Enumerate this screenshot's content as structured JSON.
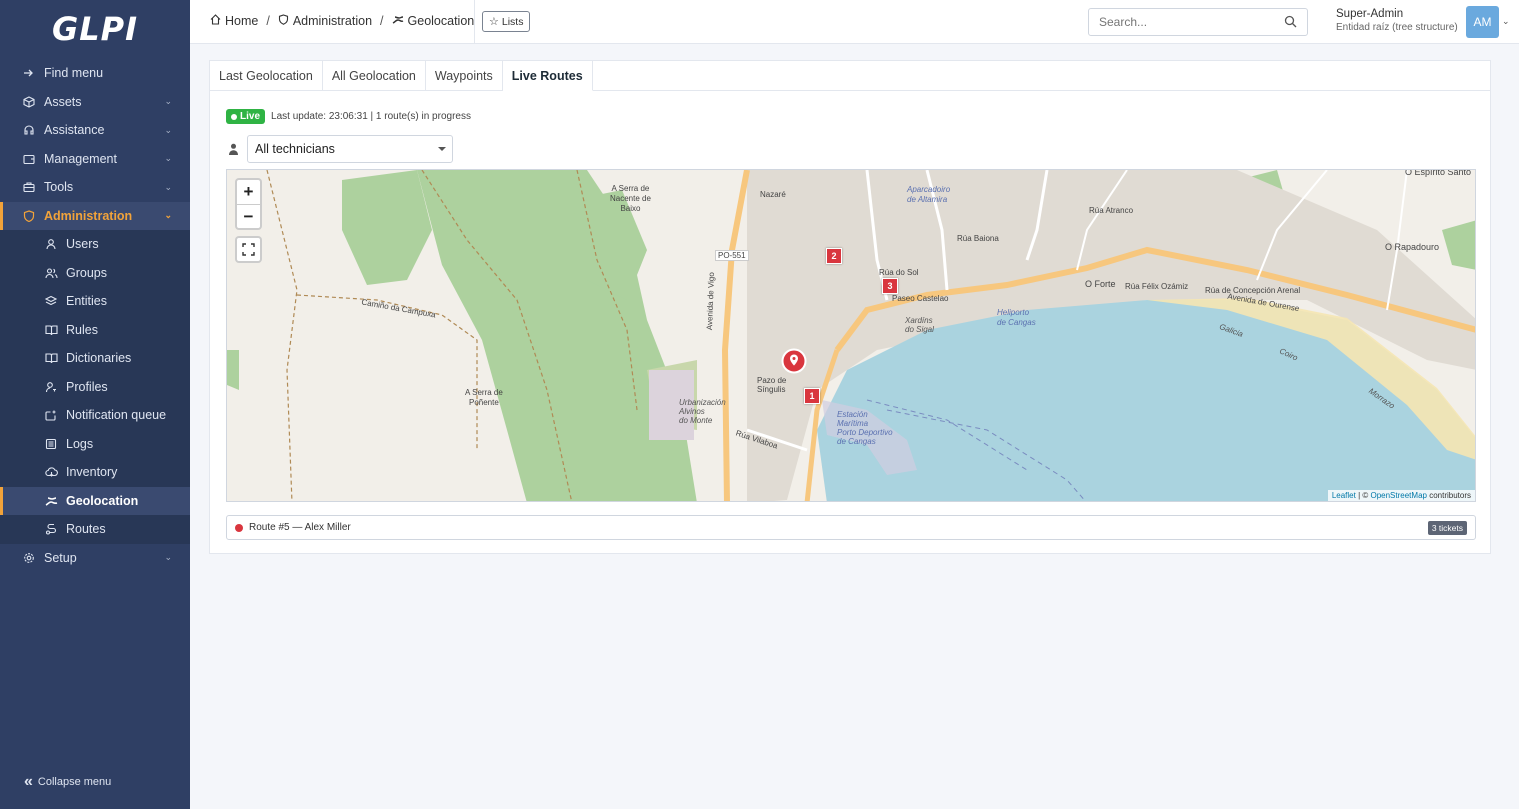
{
  "app": {
    "logo_text": "GLPI"
  },
  "sidebar": {
    "items": [
      {
        "label": "Find menu",
        "icon": "arrow-right-icon"
      },
      {
        "label": "Assets",
        "icon": "box-icon"
      },
      {
        "label": "Assistance",
        "icon": "headset-icon"
      },
      {
        "label": "Management",
        "icon": "wallet-icon"
      },
      {
        "label": "Tools",
        "icon": "briefcase-icon"
      },
      {
        "label": "Administration",
        "icon": "shield-icon"
      },
      {
        "label": "Setup",
        "icon": "gear-icon"
      }
    ],
    "admin_sub": [
      {
        "label": "Users",
        "icon": "user-icon"
      },
      {
        "label": "Groups",
        "icon": "users-icon"
      },
      {
        "label": "Entities",
        "icon": "stack-icon"
      },
      {
        "label": "Rules",
        "icon": "book-icon"
      },
      {
        "label": "Dictionaries",
        "icon": "book-icon"
      },
      {
        "label": "Profiles",
        "icon": "user-key-icon"
      },
      {
        "label": "Notification queue",
        "icon": "mail-icon"
      },
      {
        "label": "Logs",
        "icon": "log-icon"
      },
      {
        "label": "Inventory",
        "icon": "cloud-icon"
      },
      {
        "label": "Geolocation",
        "icon": "route-icon"
      },
      {
        "label": "Routes",
        "icon": "route-icon"
      }
    ],
    "collapse_label": "Collapse menu",
    "accent_color": "#f2a33a",
    "bg_color": "#2f3f64"
  },
  "header": {
    "breadcrumb": [
      "Home",
      "Administration",
      "Geolocation"
    ],
    "lists_label": "Lists",
    "search_placeholder": "Search...",
    "user_name": "Super-Admin",
    "user_entity": "Entidad raíz (tree structure)",
    "avatar_initials": "AM"
  },
  "tabs": [
    "Last Geolocation",
    "All Geolocation",
    "Waypoints",
    "Live Routes"
  ],
  "active_tab": "Live Routes",
  "live": {
    "badge": "Live",
    "status_text": "Last update: 23:06:31 | 1 route(s) in progress",
    "badge_color": "#2fb344"
  },
  "filter": {
    "selected": "All technicians"
  },
  "map": {
    "zoom_in": "+",
    "zoom_out": "−",
    "attribution_leaflet": "Leaflet",
    "attribution_sep": " | © ",
    "attribution_osm": "OpenStreetMap",
    "attribution_tail": " contributors",
    "stop_markers": [
      "1",
      "2",
      "3"
    ],
    "labels": {
      "serra_nacente": "A Serra de\nNacente de\nBaixo",
      "serra_ponente": "A Serra de\nPoñente",
      "nazare": "Nazaré",
      "po551": "PO-551",
      "aparcadoiro": "Aparcadoiro\nde Altamira",
      "o_forte": "O Forte",
      "o_rapadouro": "O Rapadouro",
      "o_espirito": "O Espírito Santo",
      "paseo_castelao": "Paseo Castelao",
      "xardins": "Xardíns\ndo Sigal",
      "heliporto": "Heliporto\nde Cangas",
      "pazo": "Pazo de\nSíngulis",
      "urbanizacion": "Urbanización\nAlvinos\ndo Monte",
      "estacion": "Estación\nMarítima\nPorto Deportivo\nde Cangas",
      "avenida_vigo": "Avenida de Vigo",
      "avenida_ourense": "Avenida de Ourense",
      "rua_baiona": "Rúa Baiona",
      "rua_do_sol": "Rúa do Sol",
      "rua_vilaboa": "Rúa Vilaboa",
      "rua_atranco": "Rúa Atranco",
      "rua_concepcion": "Rúa de Concepción Arenal",
      "rua_felix": "Rúa Félix Ozámiz",
      "camino_campuxa": "Camiño da Campuxa",
      "galicia": "Galicia",
      "coiro": "Coiro",
      "morrazo": "Morrazo"
    },
    "colors": {
      "water": "#aad3df",
      "forest": "#add19e",
      "land": "#f2efe9",
      "road_major": "#f7c77e"
    }
  },
  "route": {
    "label": "Route #5 — Alex Miller",
    "tickets": "3 tickets",
    "color": "#d9363e"
  }
}
